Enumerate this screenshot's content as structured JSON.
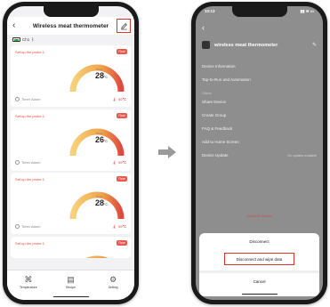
{
  "left_phone": {
    "header": {
      "title": "Wireless meat thermometer"
    },
    "status": {
      "battery_text": "Ch1"
    },
    "cards": [
      {
        "probe_label": "Set up the probe 1",
        "badge": "Rare",
        "temp_label": "Temp",
        "temp": "28",
        "unit": "°C",
        "timer": "Timer Alarm",
        "target": "55℃"
      },
      {
        "probe_label": "Set up the probe 1",
        "badge": "Rare",
        "temp_label": "Temp",
        "temp": "26",
        "unit": "°C",
        "timer": "Timer Alarm",
        "target": "55℃"
      },
      {
        "probe_label": "Set up the probe 1",
        "badge": "Rare",
        "temp_label": "Temp",
        "temp": "28",
        "unit": "°C",
        "timer": "Timer Alarm",
        "target": "55℃"
      },
      {
        "probe_label": "Set up the probe 1",
        "badge": "Rare"
      }
    ],
    "tabs": [
      {
        "icon": "chart-icon",
        "label": "Temperature"
      },
      {
        "icon": "recipe-icon",
        "label": "Recipe"
      },
      {
        "icon": "gear-icon",
        "label": "Setting"
      }
    ]
  },
  "right_phone": {
    "status": {
      "time": "10:13",
      "signals": "▮▮ ≋ ▭"
    },
    "device_name": "wireless meat thermometer",
    "menu": [
      {
        "label": "Device Information",
        "value": ""
      },
      {
        "label": "Tap-to-Run and Automation",
        "value": ""
      },
      {
        "section": "Others"
      },
      {
        "label": "Share Device",
        "value": ""
      },
      {
        "label": "Create Group",
        "value": ""
      },
      {
        "label": "FAQ & Feedback",
        "value": ""
      },
      {
        "label": "Add to Home Screen",
        "value": ""
      },
      {
        "label": "Device Update",
        "value": "No updates available"
      }
    ],
    "remove_label": "Remove Device",
    "sheet": {
      "title": "Disconnect",
      "option": "Disconnect and wipe data",
      "cancel": "Cancel"
    }
  },
  "colors": {
    "accent_red": "#d9352b",
    "gauge_orange": "#f1a34a"
  }
}
